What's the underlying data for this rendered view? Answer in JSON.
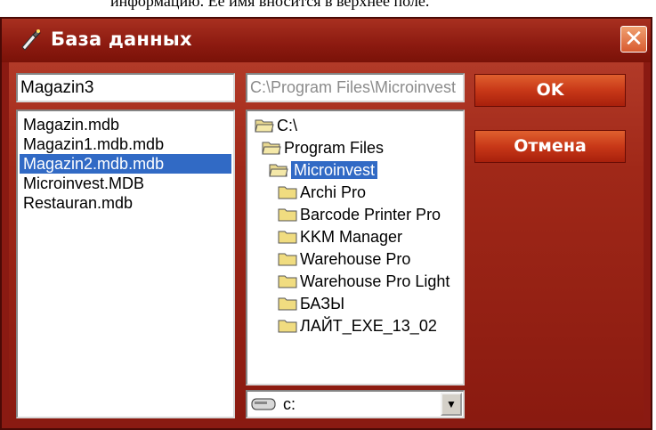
{
  "background_text": "информацию. Ее имя вносится в верхнее поле.",
  "window": {
    "title": "База данных",
    "title_icon": "database-wand-icon",
    "close_label": "✕"
  },
  "form": {
    "name_value": "Magazin3",
    "path_value": "C:\\Program Files\\Microinvest",
    "ok_label": "OK",
    "cancel_label": "Отмена"
  },
  "files": [
    {
      "name": "Magazin.mdb",
      "selected": false
    },
    {
      "name": "Magazin1.mdb.mdb",
      "selected": false
    },
    {
      "name": "Magazin2.mdb.mdb",
      "selected": true
    },
    {
      "name": "Microinvest.MDB",
      "selected": false
    },
    {
      "name": "Restauran.mdb",
      "selected": false
    }
  ],
  "directories": [
    {
      "name": "C:\\",
      "selected": false
    },
    {
      "name": "Program Files",
      "selected": false
    },
    {
      "name": "Microinvest",
      "selected": true
    },
    {
      "name": "Archi Pro",
      "selected": false
    },
    {
      "name": "Barcode Printer Pro",
      "selected": false
    },
    {
      "name": "KKM Manager",
      "selected": false
    },
    {
      "name": "Warehouse Pro",
      "selected": false
    },
    {
      "name": "Warehouse Pro Light",
      "selected": false
    },
    {
      "name": "БАЗЫ",
      "selected": false
    },
    {
      "name": "ЛАЙТ_EXE_13_02",
      "selected": false
    }
  ],
  "drive": {
    "label": "c:",
    "icon": "hard-drive-icon"
  },
  "colors": {
    "window_bg": "#8a1a12",
    "selection": "#316ac5",
    "button": "#c83818"
  }
}
